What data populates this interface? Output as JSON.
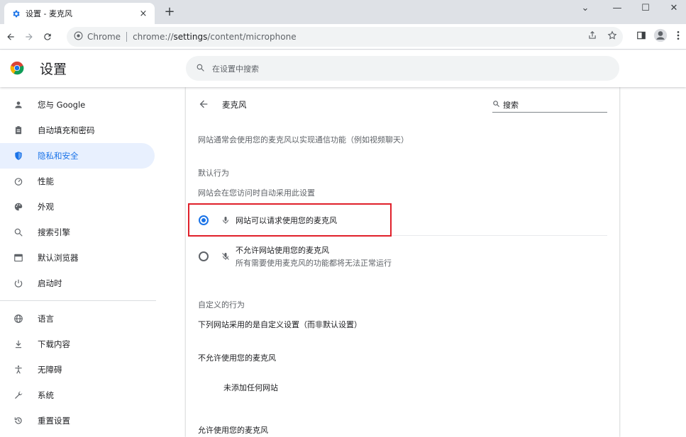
{
  "tab": {
    "title": "设置 - 麦克风",
    "close": "×",
    "new_tab": "+"
  },
  "window": {
    "minimize": "—",
    "maximize": "☐",
    "close": "✕",
    "dropdown": "⌄"
  },
  "toolbar": {
    "omnibox_site": "Chrome",
    "omnibox_url_prefix": "chrome://",
    "omnibox_url_path": "settings",
    "omnibox_url_rest": "/content/microphone"
  },
  "header": {
    "title": "设置",
    "search_placeholder": "在设置中搜索"
  },
  "sidebar": {
    "items": [
      {
        "label": "您与 Google",
        "icon": "person-icon"
      },
      {
        "label": "自动填充和密码",
        "icon": "clipboard-icon"
      },
      {
        "label": "隐私和安全",
        "icon": "shield-icon",
        "active": true
      },
      {
        "label": "性能",
        "icon": "gauge-icon"
      },
      {
        "label": "外观",
        "icon": "palette-icon"
      },
      {
        "label": "搜索引擎",
        "icon": "search-icon"
      },
      {
        "label": "默认浏览器",
        "icon": "browser-icon"
      },
      {
        "label": "启动时",
        "icon": "power-icon"
      },
      {
        "label": "语言",
        "icon": "globe-icon"
      },
      {
        "label": "下载内容",
        "icon": "download-icon"
      },
      {
        "label": "无障碍",
        "icon": "accessibility-icon"
      },
      {
        "label": "系统",
        "icon": "wrench-icon"
      },
      {
        "label": "重置设置",
        "icon": "reset-icon"
      }
    ]
  },
  "main": {
    "title": "麦克风",
    "search_placeholder": "搜索",
    "description": "网站通常会使用您的麦克风以实现通信功能（例如视频聊天）",
    "default_behavior_heading": "默认行为",
    "default_behavior_sub": "网站会在您访问时自动采用此设置",
    "option_allow": "网站可以请求使用您的麦克风",
    "option_block": "不允许网站使用您的麦克风",
    "option_block_sub": "所有需要使用麦克风的功能都将无法正常运行",
    "selected_option": "allow",
    "custom_heading": "自定义的行为",
    "custom_sub": "下列网站采用的是自定义设置（而非默认设置）",
    "blocked_heading": "不允许使用您的麦克风",
    "blocked_empty": "未添加任何网站",
    "allowed_heading": "允许使用您的麦克风"
  },
  "colors": {
    "accent": "#1a73e8",
    "highlight_box": "#e0202a"
  }
}
